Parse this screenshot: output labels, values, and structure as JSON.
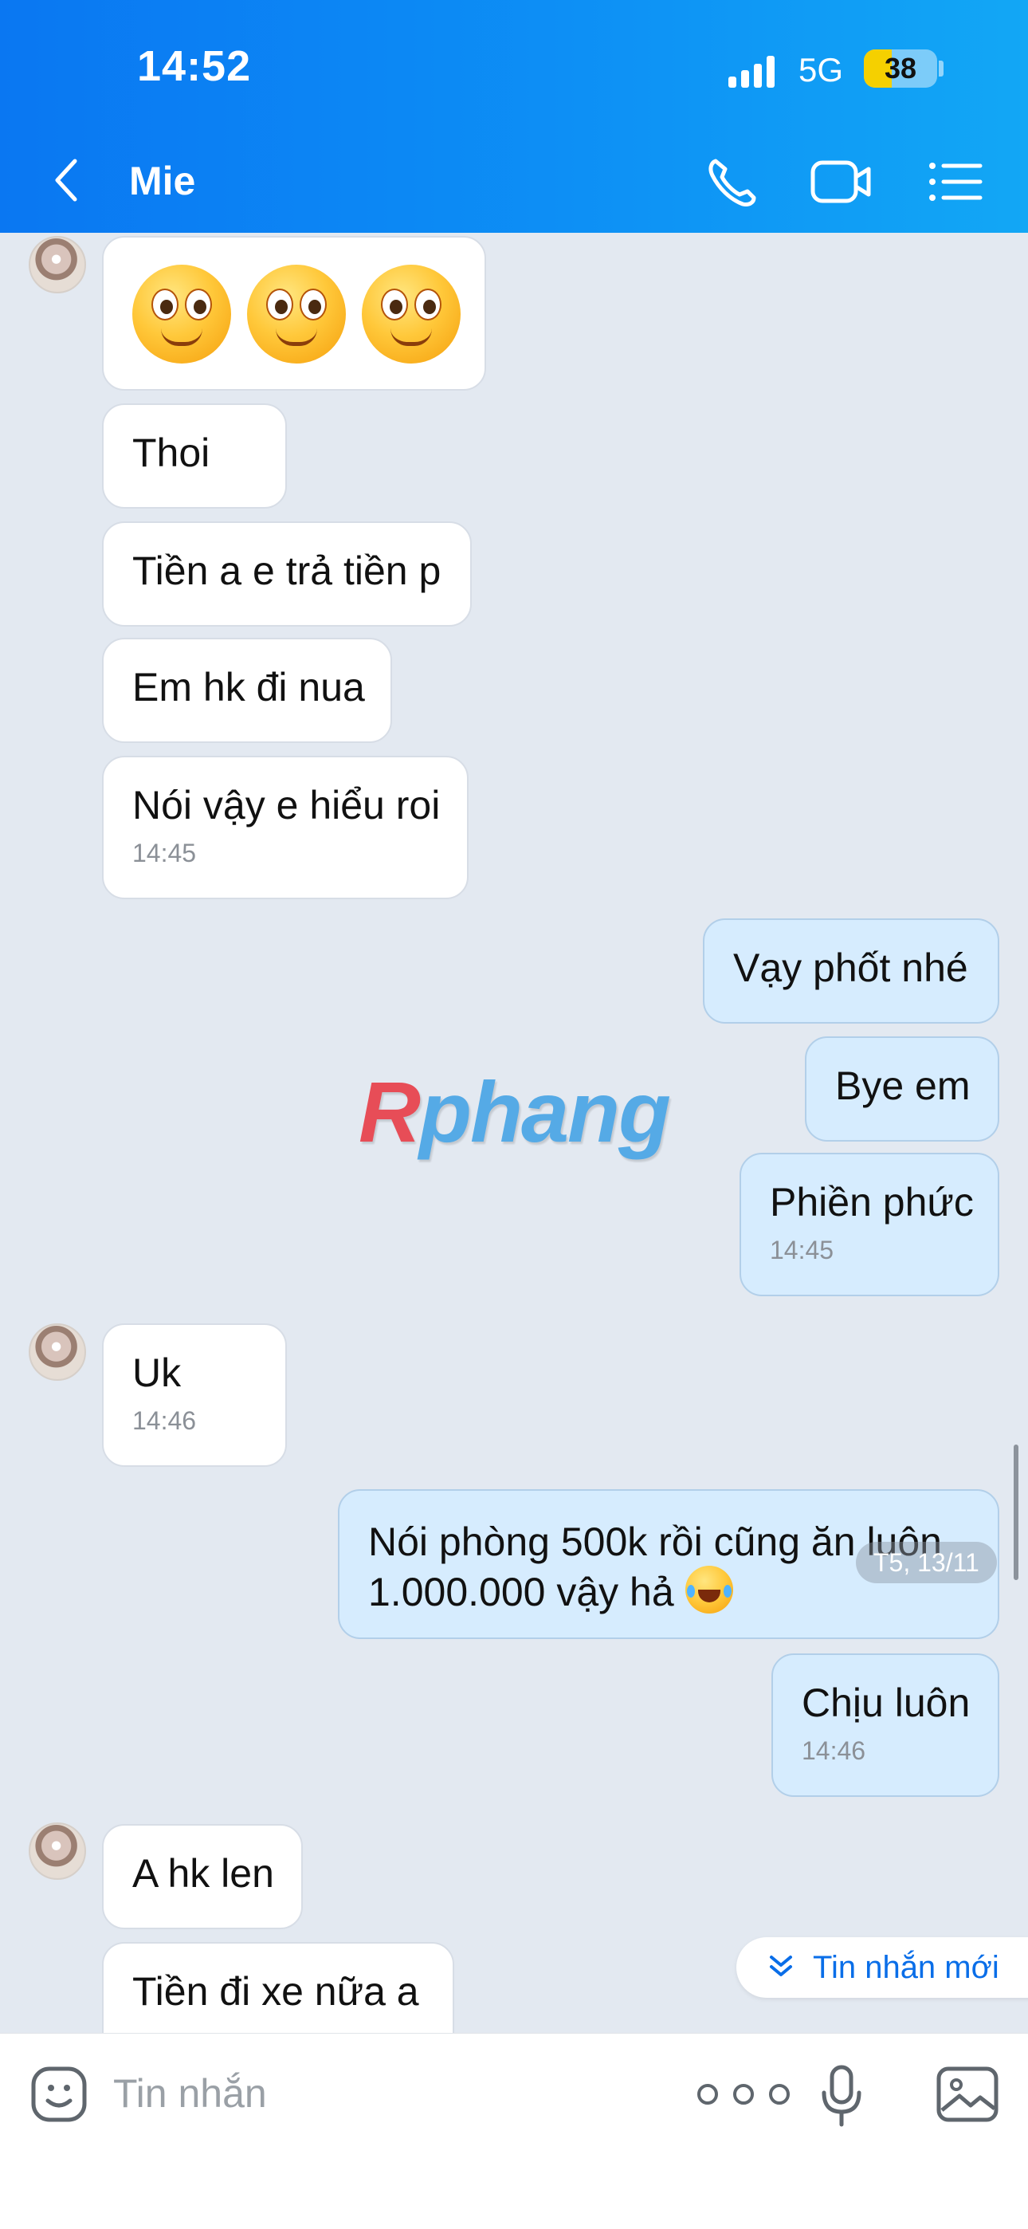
{
  "status_bar": {
    "time": "14:52",
    "network": "5G",
    "battery": "38"
  },
  "header": {
    "title": "Mie"
  },
  "messages": [
    {
      "dir": "in",
      "text": "Thoi"
    },
    {
      "dir": "in",
      "text": "Tiền a e trả tiền p"
    },
    {
      "dir": "in",
      "text": "Em hk đi nua"
    },
    {
      "dir": "in",
      "text": "Nói vậy e hiểu roi",
      "time": "14:45"
    },
    {
      "dir": "out",
      "text": "Vạy phốt nhé"
    },
    {
      "dir": "out",
      "text": "Bye em"
    },
    {
      "dir": "out",
      "text": "Phiền phức",
      "time": "14:45"
    },
    {
      "dir": "in",
      "text": "Uk",
      "time": "14:46"
    },
    {
      "dir": "out",
      "text": "Nói phòng 500k rồi cũng ăn luôn",
      "text2": "1.000.000 vậy hả"
    },
    {
      "dir": "out",
      "text": "Chịu luôn",
      "time": "14:46"
    },
    {
      "dir": "in",
      "text": "A hk len"
    },
    {
      "dir": "in",
      "text": "Tiền đi  xe nữa a"
    }
  ],
  "date_pill": "T5, 13/11",
  "watermark": {
    "r": "R",
    "rest": "phang"
  },
  "new_messages_label": "Tin nhắn mới",
  "input": {
    "placeholder": "Tin nhắn"
  },
  "icons": [
    "back-icon",
    "phone-icon",
    "video-icon",
    "list-menu-icon",
    "sticker-icon",
    "more-icon",
    "mic-icon",
    "image-icon",
    "chevron-double-down-icon"
  ],
  "colors": {
    "header_start": "#0a77f2",
    "header_end": "#12a7f5",
    "outgoing_bubble": "#d6ecfe",
    "incoming_bubble": "#ffffff",
    "chat_bg": "#e3e9f1",
    "link_blue": "#0a6ee8"
  }
}
